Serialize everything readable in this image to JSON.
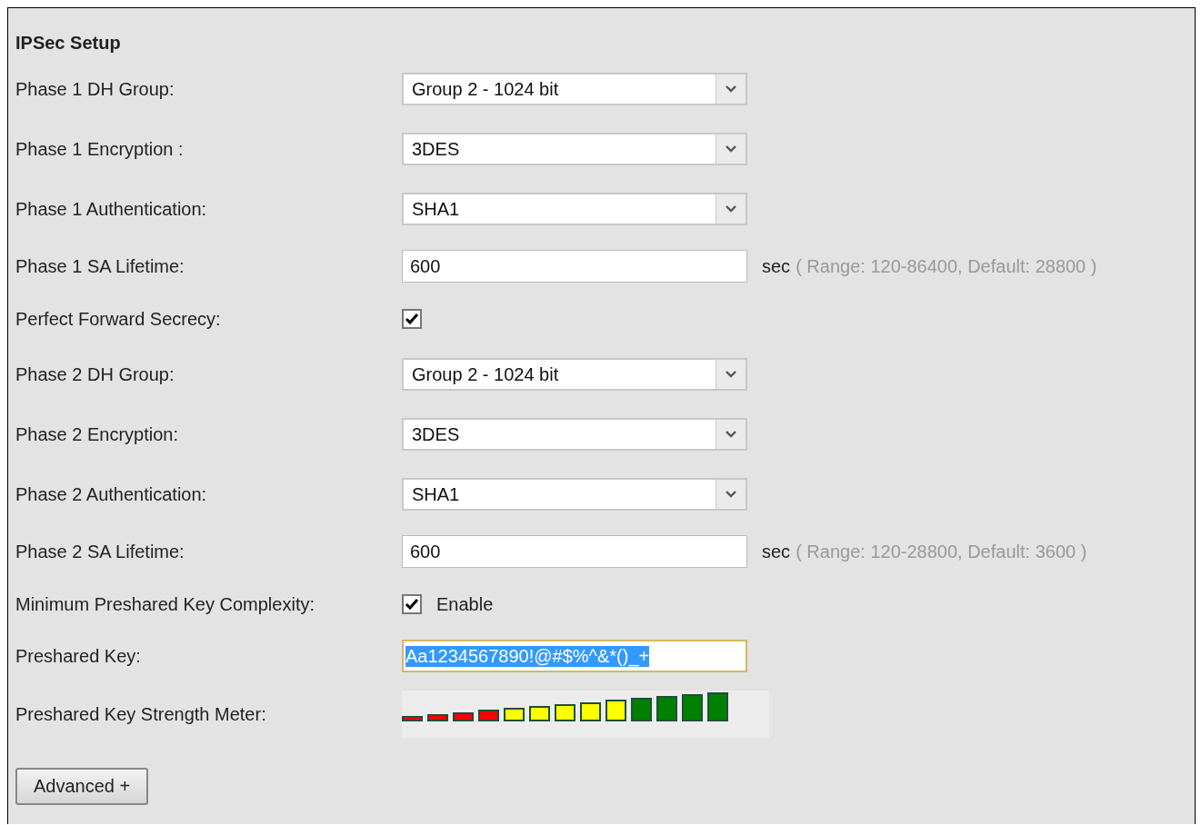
{
  "section": {
    "title": "IPSec Setup"
  },
  "rows": [
    {
      "kind": "select",
      "label": "Phase 1 DH Group:",
      "value": "Group 2 - 1024 bit"
    },
    {
      "kind": "select",
      "label": "Phase 1 Encryption :",
      "value": "3DES"
    },
    {
      "kind": "select",
      "label": "Phase 1 Authentication:",
      "value": "SHA1"
    },
    {
      "kind": "text",
      "label": "Phase 1 SA Lifetime:",
      "value": "600",
      "unit": "sec",
      "hint": "( Range: 120-86400, Default: 28800 )"
    },
    {
      "kind": "checkbox",
      "label": "Perfect Forward Secrecy:",
      "checked": true
    },
    {
      "kind": "select",
      "label": "Phase 2 DH Group:",
      "value": "Group 2 - 1024 bit"
    },
    {
      "kind": "select",
      "label": "Phase 2 Encryption:",
      "value": "3DES"
    },
    {
      "kind": "select",
      "label": "Phase 2 Authentication:",
      "value": "SHA1"
    },
    {
      "kind": "text",
      "label": "Phase 2 SA Lifetime:",
      "value": "600",
      "unit": "sec",
      "hint": "( Range: 120-28800, Default: 3600 )"
    },
    {
      "kind": "checkbox",
      "label": "Minimum Preshared Key Complexity:",
      "checked": true,
      "option": "Enable"
    },
    {
      "kind": "key",
      "label": "Preshared Key:",
      "value": "Aa1234567890!@#$%^&*()_+",
      "selected": true
    },
    {
      "kind": "meter",
      "label": "Preshared Key Strength Meter:"
    }
  ],
  "buttons": [
    {
      "label": "Advanced +"
    }
  ]
}
